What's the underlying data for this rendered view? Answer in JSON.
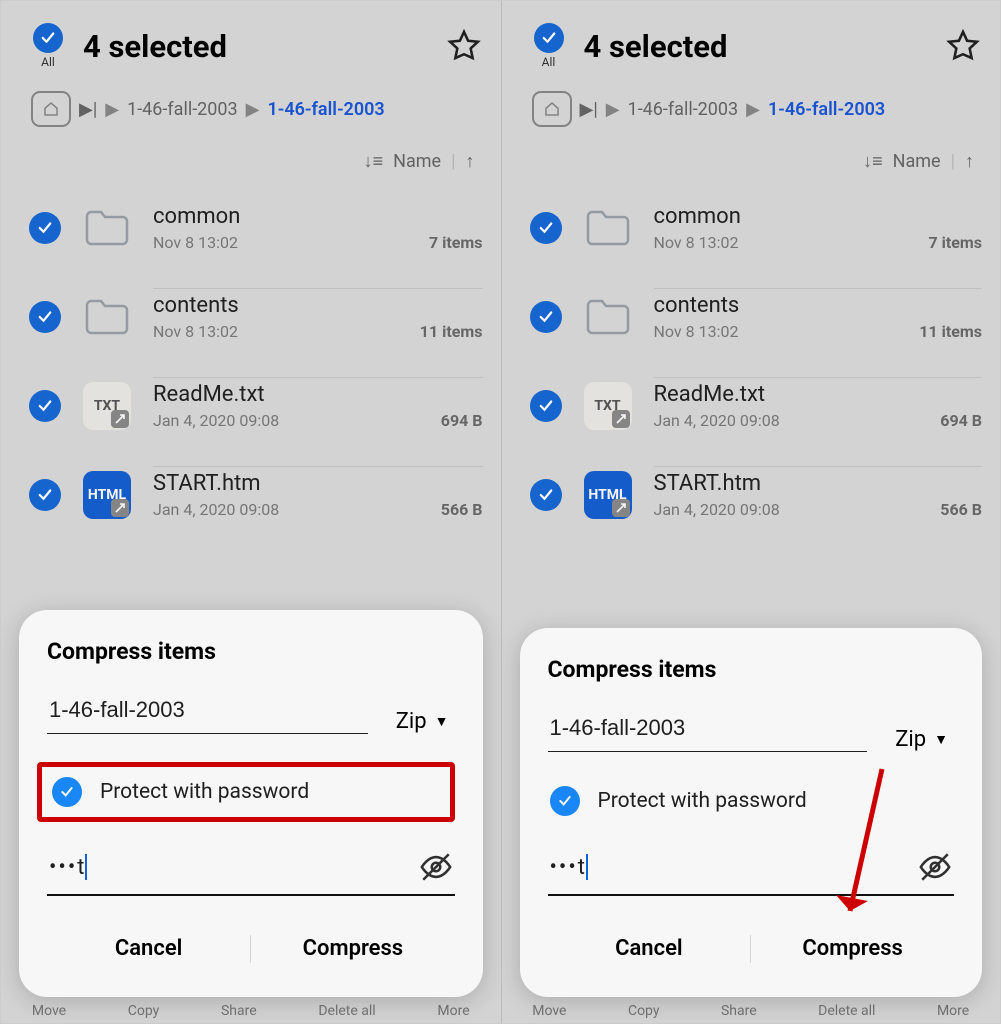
{
  "header": {
    "all_label": "All",
    "title": "4 selected"
  },
  "breadcrumb": {
    "path1": "1-46-fall-2003",
    "active": "1-46-fall-2003"
  },
  "sort": {
    "label": "Name"
  },
  "files": [
    {
      "name": "common",
      "date": "Nov 8 13:02",
      "meta": "7 items",
      "type": "folder"
    },
    {
      "name": "contents",
      "date": "Nov 8 13:02",
      "meta": "11 items",
      "type": "folder"
    },
    {
      "name": "ReadMe.txt",
      "date": "Jan 4, 2020 09:08",
      "meta": "694 B",
      "type": "txt"
    },
    {
      "name": "START.htm",
      "date": "Jan 4, 2020 09:08",
      "meta": "566 B",
      "type": "html"
    }
  ],
  "modal": {
    "title": "Compress items",
    "filename": "1-46-fall-2003",
    "format": "Zip",
    "protect_label": "Protect with password",
    "password_masked": "•••",
    "password_tail": "t",
    "cancel": "Cancel",
    "confirm": "Compress"
  },
  "bottombar": {
    "b1": "Move",
    "b2": "Copy",
    "b3": "Share",
    "b4": "Delete all",
    "b5": "More"
  }
}
